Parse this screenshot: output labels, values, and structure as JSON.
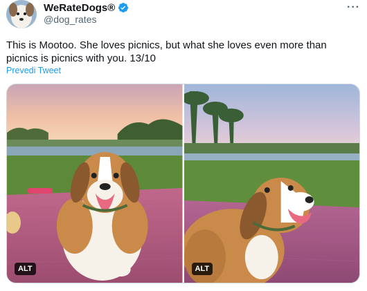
{
  "tweet": {
    "author": {
      "display_name": "WeRateDogs®",
      "handle": "@dog_rates",
      "verified_icon": "verified-badge-icon",
      "verified_color": "#1d9bf0"
    },
    "more_label": "···",
    "text_line1": "This is Mootoo. She loves picnics, but what she loves even more than",
    "text_line2": "picnics is picnics with you. 13/10",
    "translate_label": "Prevedi Tweet",
    "media": [
      {
        "alt_label": "ALT"
      },
      {
        "alt_label": "ALT"
      }
    ]
  }
}
